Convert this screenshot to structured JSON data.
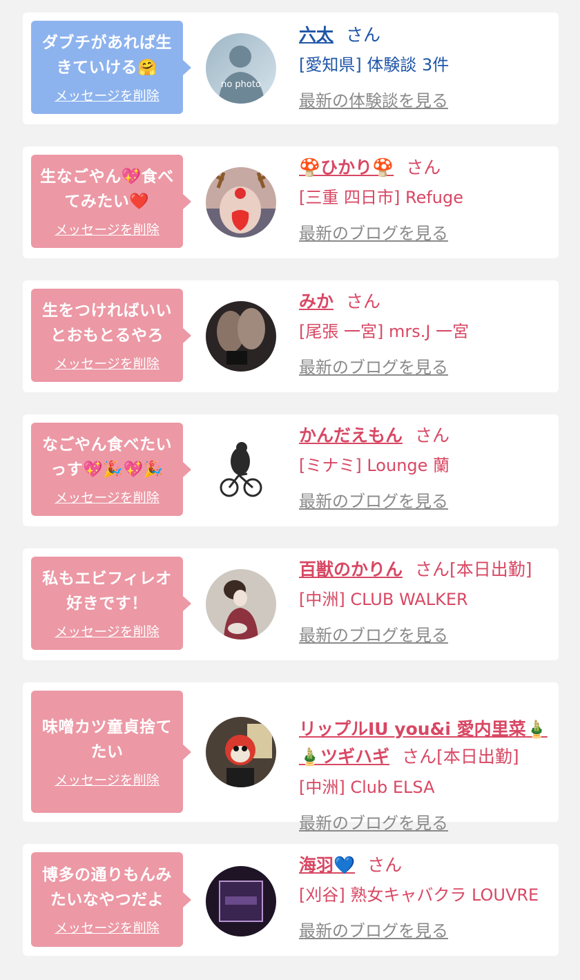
{
  "delete_label": "メッセージを削除",
  "colors": {
    "blue_bubble": "#8db3ee",
    "pink_bubble": "#ec98a5",
    "blue_text": "#1e56a8",
    "pink_text": "#d84763",
    "link_gray": "#8a8a8a"
  },
  "items": [
    {
      "bubble": "ダブチがあれば生\nきていける🤗",
      "name": "六太",
      "suffix": "さん",
      "shop": "[愛知県] 体験談 3件",
      "latest": "最新の体験談を見る",
      "theme": "blue",
      "avatar": "no-photo-avatar",
      "avatar_text": "no photo"
    },
    {
      "bubble": "生なごやん💖食べ\nてみたい❤️",
      "name": "🍄ひかり🍄",
      "suffix": "さん",
      "shop": "[三重 四日市] Refuge",
      "latest": "最新のブログを見る",
      "theme": "pink",
      "avatar": "reindeer-photo-avatar"
    },
    {
      "bubble": "生をつければいい\nとおもとるやろ",
      "name": "みか",
      "suffix": "さん",
      "shop": "[尾張 一宮] mrs.J 一宮",
      "latest": "最新のブログを見る",
      "theme": "pink",
      "avatar": "legs-photo-avatar"
    },
    {
      "bubble": "なごやん食べたい\nっす💖🎉💖🎉",
      "name": "かんだえもん",
      "suffix": "さん",
      "shop": "[ミナミ] Lounge 蘭",
      "latest": "最新のブログを見る",
      "theme": "pink",
      "avatar": "bear-bicycle-avatar"
    },
    {
      "bubble": "私もエビフィレオ\n好きです！",
      "name": "百獣のかりん",
      "suffix": "さん[本日出勤]",
      "shop": "[中洲] CLUB WALKER",
      "latest": "最新のブログを見る",
      "theme": "pink",
      "avatar": "kimono-photo-avatar"
    },
    {
      "bubble": "味噌カツ童貞捨て\nたい",
      "name": "リップルIU you&i 愛内里菜🎍\n🎍ツギハギ",
      "suffix": "さん[本日出勤]",
      "shop": "[中洲] Club ELSA",
      "latest": "最新のブログを見る",
      "theme": "pink",
      "avatar": "mask-photo-avatar"
    },
    {
      "bubble": "博多の通りもんみ\nたいなやつだよ",
      "name": "海羽💙",
      "suffix": "さん",
      "shop": "[刈谷] 熟女キャバクラ LOUVRE",
      "latest": "最新のブログを見る",
      "theme": "pink",
      "avatar": "louvre-logo-avatar"
    }
  ]
}
